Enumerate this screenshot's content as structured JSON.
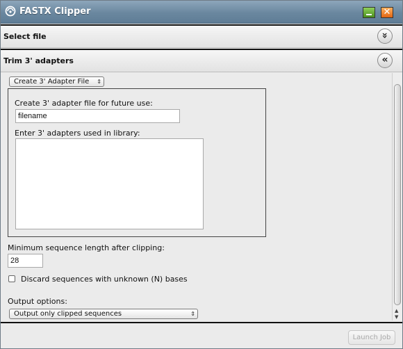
{
  "window": {
    "title": "FASTX Clipper",
    "close_glyph": "✕"
  },
  "sections": {
    "select_file": {
      "title": "Select file",
      "toggle_glyph": "»"
    },
    "trim_adapters": {
      "title": "Trim 3' adapters",
      "toggle_glyph": "«"
    }
  },
  "form": {
    "adapter_mode_select": {
      "selected": "Create 3' Adapter File",
      "arrow": "⇕"
    },
    "adapter_file_label": "Create 3' adapter file for future use:",
    "adapter_file_value": "filename",
    "adapters_label": "Enter 3' adapters used in library:",
    "adapters_value": "",
    "min_length_label": "Minimum sequence length after clipping:",
    "min_length_value": "28",
    "discard_unknown_label": "Discard sequences with unknown (N) bases",
    "discard_unknown_checked": false,
    "output_options_label": "Output options:",
    "output_select": {
      "selected": "Output only clipped sequences",
      "arrow": "⇕"
    }
  },
  "footer": {
    "launch_label": "Launch Job"
  },
  "colors": {
    "titlebar": "#6a879f",
    "minimize": "#5aa628",
    "close": "#f07d2a",
    "panel": "#ebebeb"
  },
  "icons": {
    "title_logo": "fastx-logo-icon",
    "collapse_select": "double-chevron-down-icon",
    "collapse_trim": "double-chevron-left-icon"
  }
}
